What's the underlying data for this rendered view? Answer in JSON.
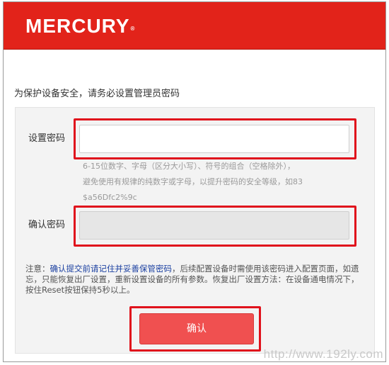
{
  "header": {
    "logo_text": "MERCURY",
    "logo_mark": "®"
  },
  "page": {
    "heading": "为保护设备安全，请务必设置管理员密码"
  },
  "form": {
    "password_label": "设置密码",
    "password_value": "",
    "hint_lines": [
      "6-15位数字、字母（区分大小写）、符号的组合（空格除外），",
      "避免使用有规律的纯数字或字母，以提升密码的安全等级，如83",
      "$a56Dfc2%9c"
    ],
    "confirm_label": "确认密码",
    "confirm_value": ""
  },
  "note": {
    "prefix": "注意：",
    "emphasis": "确认提交前请记住并妥善保管密码",
    "text": "，后续配置设备时需使用该密码进入配置页面，如遗忘，只能恢复出厂设置，重新设置设备的所有参数。恢复出厂设置方法：在设备通电情况下，按住Reset按钮保持5秒以上。"
  },
  "button": {
    "confirm_label": "确认"
  },
  "watermark": {
    "text": "http://www.192ly.com"
  },
  "colors": {
    "brand_red": "#e2231a",
    "button_red": "#f05050",
    "highlight_red": "#e0121c",
    "note_link_blue": "#1a3fa0"
  }
}
